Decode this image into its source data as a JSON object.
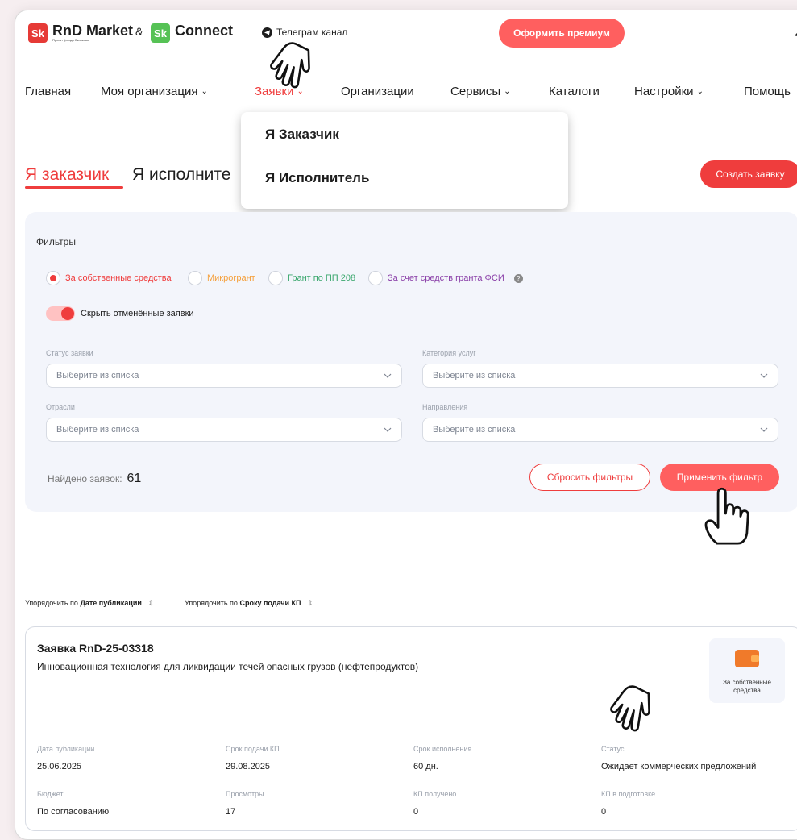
{
  "header": {
    "brand1": "RnD Market",
    "brand_amp": "&",
    "brand2": "Connect",
    "logo_letters": "Sk",
    "brand_small": "Проект фонда Сколково",
    "telegram": "Телеграм канал",
    "premium_button": "Оформить премиум",
    "user_icon": "user-icon"
  },
  "nav": {
    "items": [
      "Главная",
      "Моя организация",
      "Заявки",
      "Организации",
      "Сервисы",
      "Каталоги",
      "Настройки",
      "Помощь"
    ],
    "chevron": "⌄"
  },
  "dropdown": {
    "items": [
      "Я Заказчик",
      "Я Исполнитель"
    ]
  },
  "tabs": {
    "customer": "Я заказчик",
    "executor": "Я исполните",
    "create_button": "Создать заявку"
  },
  "filters": {
    "title": "Фильтры",
    "radios": [
      {
        "label": "За собственные средства",
        "color": "#ef3d3d",
        "checked": true
      },
      {
        "label": "Микрогрант",
        "color": "#f5a03c",
        "checked": false
      },
      {
        "label": "Грант по ПП 208",
        "color": "#3aa76d",
        "checked": false
      },
      {
        "label": "За счет средств гранта ФСИ",
        "color": "#8a3fa8",
        "checked": false
      }
    ],
    "help": "?",
    "toggle_label": "Скрыть отменённые заявки",
    "fields": {
      "status_label": "Статус заявки",
      "category_label": "Категория услуг",
      "industry_label": "Отрасли",
      "direction_label": "Направления",
      "placeholder": "Выберите из списка"
    },
    "found_label": "Найдено заявок:",
    "found_count": "61",
    "reset_button": "Сбросить фильтры",
    "apply_button": "Применить фильтр"
  },
  "sort": {
    "prefix": "Упорядочить по",
    "by_date": "Дате публикации",
    "by_deadline": "Сроку подачи КП",
    "arrow": "⇕"
  },
  "card": {
    "title": "Заявка RnD-25-03318",
    "description": "Инновационная технология для ликвидации течей опасных грузов (нефтепродуктов)",
    "funding": "За собственные средства",
    "info": [
      {
        "label": "Дата публикации",
        "value": "25.06.2025"
      },
      {
        "label": "Срок подачи КП",
        "value": "29.08.2025"
      },
      {
        "label": "Срок исполнения",
        "value": "60 дн."
      },
      {
        "label": "Статус",
        "value": "Ожидает коммерческих предложений"
      },
      {
        "label": "Бюджет",
        "value": "По согласованию"
      },
      {
        "label": "Просмотры",
        "value": "17"
      },
      {
        "label": "КП получено",
        "value": "0"
      },
      {
        "label": "КП в подготовке",
        "value": "0"
      }
    ]
  },
  "colors": {
    "accent": "#ef3d3d",
    "button": "#ff5f5f",
    "panel": "#f3f5fb"
  }
}
